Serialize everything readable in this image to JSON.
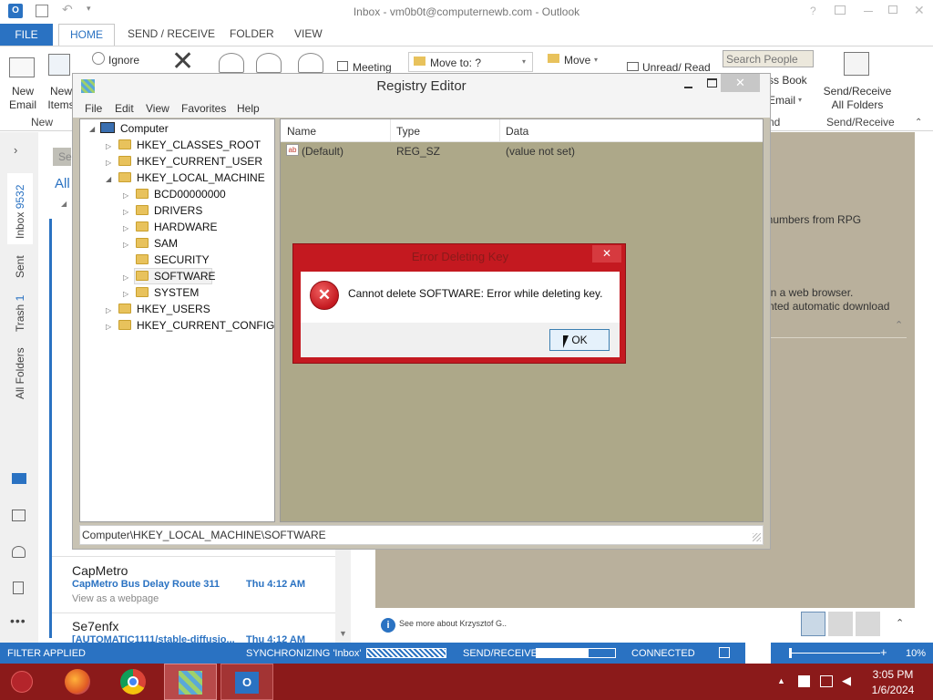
{
  "outlook": {
    "title": "Inbox - vm0b0t@computernewb.com - Outlook",
    "tabs": [
      "FILE",
      "HOME",
      "SEND / RECEIVE",
      "FOLDER",
      "VIEW"
    ],
    "ribbon": {
      "new_email": "New\nEmail",
      "new_items": "New\nItems",
      "new_group": "New",
      "ignore": "Ignore",
      "meeting": "Meeting",
      "move_to": "Move to: ?",
      "move": "Move",
      "unread_read": "Unread/ Read",
      "search_people_placeholder": "Search People",
      "address_book": "ss Book",
      "email_filter": "Email",
      "send_receive_all": "Send/Receive\nAll Folders",
      "send_receive_group": "Send/Receive",
      "find_group": "nd"
    },
    "nav": {
      "inbox": "Inbox",
      "inbox_count": "9532",
      "sent": "Sent",
      "trash": "Trash",
      "trash_count": "1",
      "all_folders": "All Folders"
    },
    "list": {
      "search_frag": "Se",
      "all_frag": "All",
      "messages": [
        {
          "sender": "CapMetro",
          "subject": "CapMetro Bus Delay Route 311",
          "time": "Thu 4:12 AM",
          "preview": "View as a webpage"
        },
        {
          "sender": "Se7enfx",
          "subject": "[AUTOMATIC1111/stable-diffusio...",
          "time": "Thu 4:12 AM",
          "preview": ""
        }
      ]
    },
    "reading": {
      "line1": "t numbers from RPG",
      "line2": "in a web browser.",
      "line3": "nted automatic download",
      "people_pane": "See more about Krzysztof G.."
    },
    "status": {
      "filter": "FILTER APPLIED",
      "sync": "SYNCHRONIZING  'Inbox'",
      "send_receive": "SEND/RECEIVE",
      "connected": "CONNECTED",
      "zoom": "10%"
    }
  },
  "registry": {
    "title": "Registry Editor",
    "menu": [
      "File",
      "Edit",
      "View",
      "Favorites",
      "Help"
    ],
    "tree": {
      "root": "Computer",
      "hives": [
        "HKEY_CLASSES_ROOT",
        "HKEY_CURRENT_USER",
        "HKEY_LOCAL_MACHINE"
      ],
      "hklm_children": [
        "BCD00000000",
        "DRIVERS",
        "HARDWARE",
        "SAM",
        "SECURITY",
        "SOFTWARE",
        "SYSTEM"
      ],
      "more_hives": [
        "HKEY_USERS",
        "HKEY_CURRENT_CONFIG"
      ]
    },
    "columns": {
      "name": "Name",
      "type": "Type",
      "data": "Data"
    },
    "values": [
      {
        "name": "(Default)",
        "type": "REG_SZ",
        "data": "(value not set)"
      }
    ],
    "status_path": "Computer\\HKEY_LOCAL_MACHINE\\SOFTWARE"
  },
  "dialog": {
    "title": "Error Deleting Key",
    "message": "Cannot delete SOFTWARE:  Error while deleting key.",
    "ok": "OK"
  },
  "taskbar": {
    "time": "3:05 PM",
    "date": "1/6/2024"
  },
  "colors": {
    "outlook_blue": "#2a72c2",
    "taskbar": "#8b1a1a",
    "dialog_red": "#c41920"
  }
}
